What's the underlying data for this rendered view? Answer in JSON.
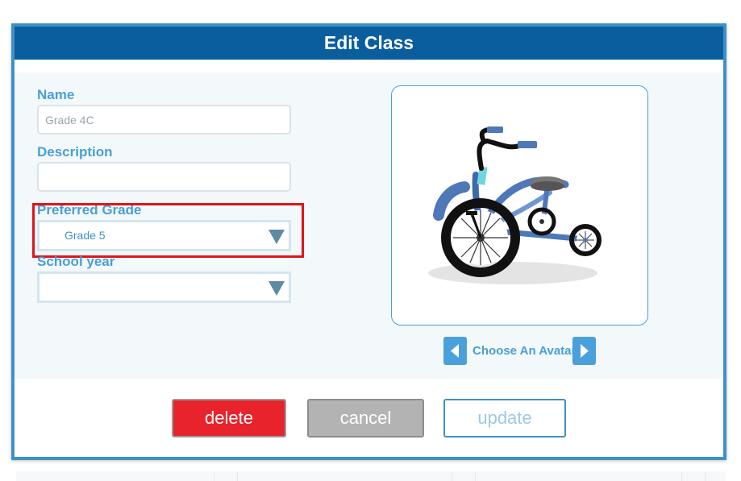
{
  "dialog": {
    "title": "Edit Class"
  },
  "form": {
    "name_label": "Name",
    "name_value": "Grade 4C",
    "description_label": "Description",
    "description_value": "",
    "preferred_grade_label": "Preferred Grade",
    "preferred_grade_value": "Grade 5",
    "school_year_label": "School year",
    "school_year_value": ""
  },
  "avatar": {
    "image": "tricycle",
    "caption": "Choose An Avatar",
    "prev_icon": "chevron-left-icon",
    "next_icon": "chevron-right-icon"
  },
  "actions": {
    "delete_label": "delete",
    "cancel_label": "cancel",
    "update_label": "update"
  },
  "colors": {
    "header": "#0a5e9e",
    "accent": "#4a9fd3",
    "delete": "#e8232b",
    "cancel": "#b3b3b3",
    "highlight": "#e0141c"
  }
}
